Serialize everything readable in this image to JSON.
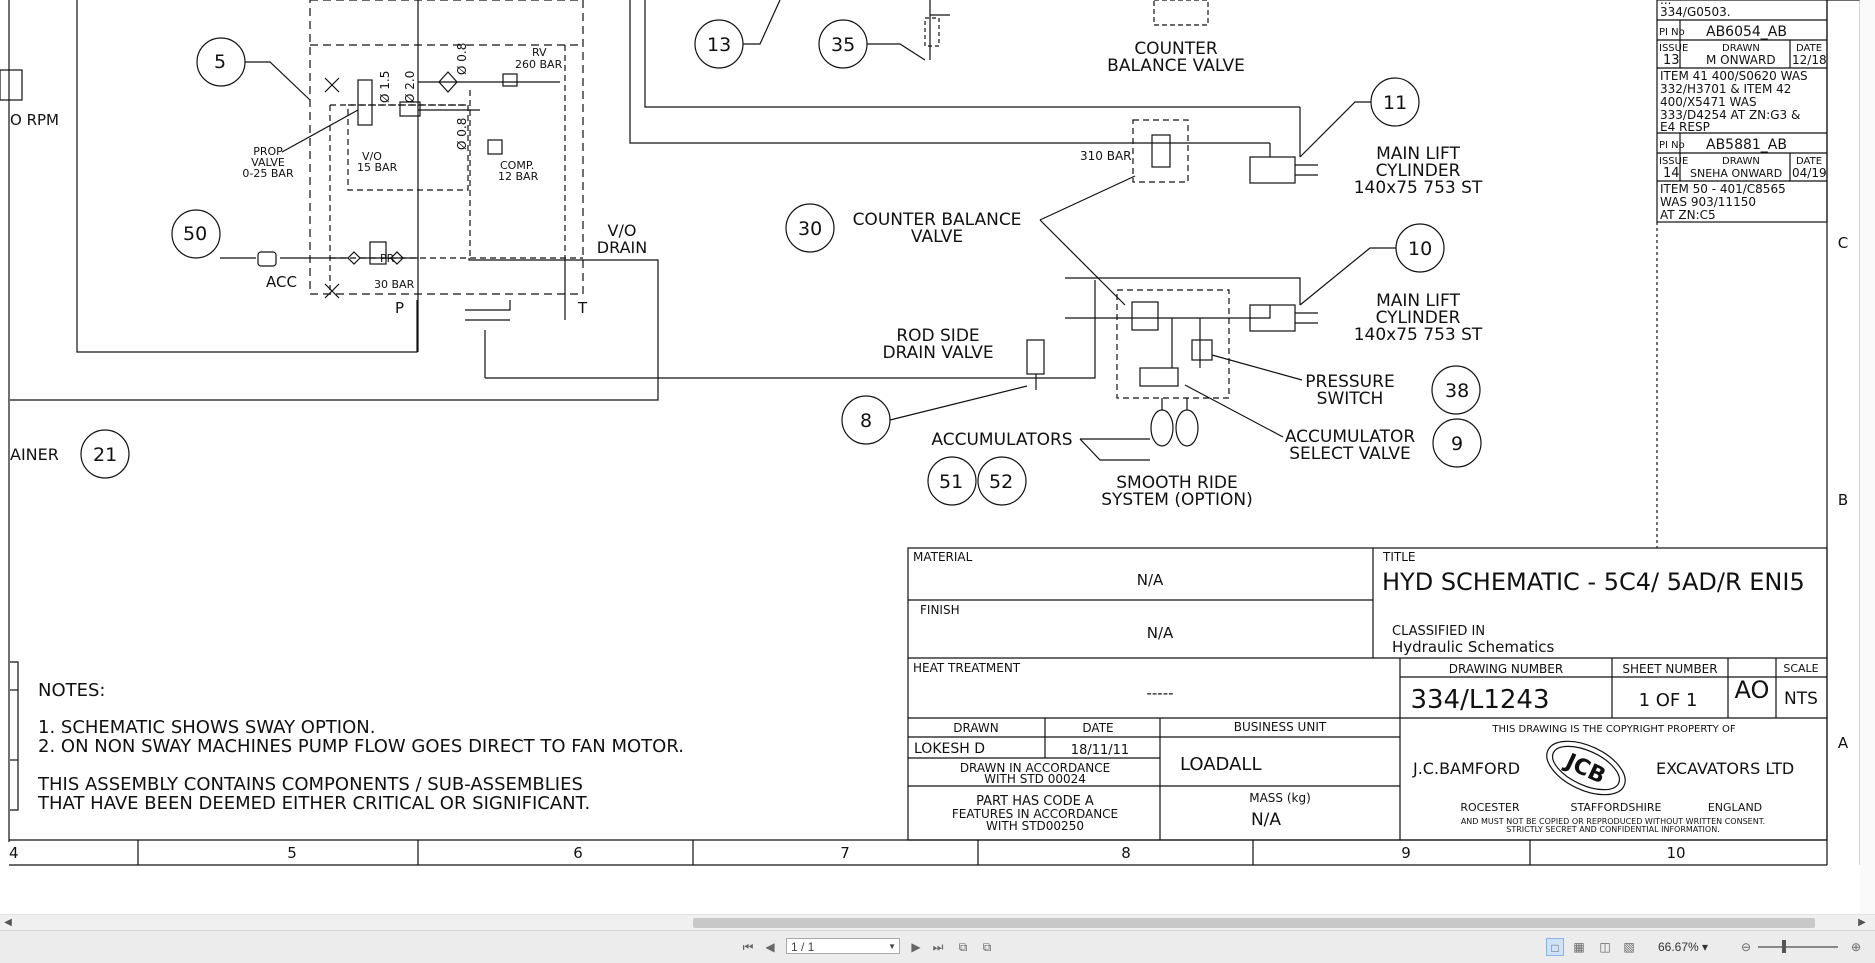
{
  "schematic": {
    "labels": {
      "rpm": "O RPM",
      "item5_num": "5",
      "prop_valve": [
        "PROP",
        "VALVE",
        "0-25 BAR"
      ],
      "vo_15": [
        "V/O",
        "15 BAR"
      ],
      "rv": [
        "RV",
        "260 BAR"
      ],
      "comp": [
        "COMP.",
        "12 BAR"
      ],
      "orifice_15": "Ø 1.5",
      "orifice_20": "Ø 2.0",
      "orifice_08a": "Ø 0.8",
      "orifice_08b": "Ø 0.8",
      "item50_num": "50",
      "acc": "ACC",
      "pr": [
        "PR",
        "30 BAR"
      ],
      "port_p": "P",
      "port_t": "T",
      "vo_drain": [
        "V/O",
        "DRAIN"
      ],
      "strainer": "AINER",
      "item21_num": "21",
      "item13_num": "13",
      "item35_num": "35",
      "counter_balance_top": [
        "COUNTER",
        "BALANCE VALVE"
      ],
      "bar310": "310 BAR",
      "item11_num": "11",
      "main_lift_1": [
        "MAIN LIFT",
        "CYLINDER",
        "140x75 753 ST"
      ],
      "item30_num": "30",
      "counter_balance_mid": [
        "COUNTER BALANCE",
        "VALVE"
      ],
      "item10_num": "10",
      "main_lift_2": [
        "MAIN LIFT",
        "CYLINDER",
        "140x75 753 ST"
      ],
      "rod_side": [
        "ROD SIDE",
        "DRAIN VALVE"
      ],
      "item8_num": "8",
      "pressure_switch": [
        "PRESSURE",
        "SWITCH"
      ],
      "item38_num": "38",
      "accumulators": "ACCUMULATORS",
      "accumulator_select": [
        "ACCUMULATOR",
        "SELECT VALVE"
      ],
      "item9_num": "9",
      "item51_num": "51",
      "item52_num": "52",
      "smooth_ride": [
        "SMOOTH RIDE",
        "SYSTEM (OPTION)"
      ]
    },
    "notes": {
      "heading": "NOTES:",
      "line1": "1. SCHEMATIC SHOWS SWAY OPTION.",
      "line2": "2. ON NON SWAY MACHINES PUMP FLOW GOES DIRECT TO FAN MOTOR.",
      "line3": "THIS ASSEMBLY CONTAINS COMPONENTS / SUB-ASSEMBLIES",
      "line4": "THAT HAVE BEEN DEEMED EITHER CRITICAL OR SIGNIFICANT."
    },
    "revisions": {
      "top_partial_1": "...",
      "top_partial_2": "334/G0503.",
      "pi1_label": "PI No",
      "pi1_value": "AB6054_AB",
      "issue_label": "ISSUE",
      "drawn_label": "DRAWN",
      "date_label": "DATE",
      "issue13": "13",
      "drawn13": "M ONWARD",
      "date13": "12/18",
      "note13": [
        "ITEM 41 400/S0620 WAS",
        "332/H3701 & ITEM 42",
        "400/X5471 WAS",
        "333/D4254 AT ZN:G3 &",
        "E4 RESP"
      ],
      "pi2_label": "PI No",
      "pi2_value": "AB5881_AB",
      "issue14": "14",
      "drawn14": "SNEHA ONWARD",
      "date14": "04/19",
      "note14": [
        "ITEM 50 - 401/C8565",
        "WAS 903/11150",
        "AT ZN:C5"
      ]
    },
    "title_block": {
      "material_label": "MATERIAL",
      "material_value": "N/A",
      "finish_label": "FINISH",
      "finish_value": "N/A",
      "heat_label": "HEAT TREATMENT",
      "heat_value": "-----",
      "title_label": "TITLE",
      "title_value": "HYD SCHEMATIC - 5C4/ 5AD/R ENI5",
      "classified_label": "CLASSIFIED IN",
      "classified_value": "Hydraulic Schematics",
      "drawing_number_label": "DRAWING NUMBER",
      "drawing_number_value": "334/L1243",
      "sheet_number_label": "SHEET NUMBER",
      "sheet_number_value": "1 OF 1",
      "size_value": "AO",
      "scale_label": "SCALE",
      "scale_value": "NTS",
      "drawn_label": "DRAWN",
      "drawn_value": "LOKESH D",
      "date_label": "DATE",
      "date_value": "18/11/11",
      "business_unit_label": "BUSINESS UNIT",
      "business_unit_value": "LOADALL",
      "accordance": [
        "DRAWN IN ACCORDANCE",
        "WITH STD 00024"
      ],
      "part_code": [
        "PART HAS CODE A",
        "FEATURES IN ACCORDANCE",
        "WITH STD00250"
      ],
      "mass_label": "MASS (kg)",
      "mass_value": "N/A",
      "copyright_top": "THIS DRAWING IS THE COPYRIGHT PROPERTY OF",
      "company_left": "J.C.BAMFORD",
      "company_right": "EXCAVATORS LTD",
      "logo_text": "JCB",
      "address": [
        "ROCESTER",
        "STAFFORDSHIRE",
        "ENGLAND"
      ],
      "copyright_bottom": [
        "AND MUST NOT BE COPIED OR REPRODUCED WITHOUT WRITTEN CONSENT.",
        "STRICTLY SECRET AND CONFIDENTIAL INFORMATION."
      ]
    },
    "grid": {
      "columns": [
        "4",
        "5",
        "6",
        "7",
        "8",
        "9",
        "10"
      ],
      "rows": [
        "C",
        "B",
        "A"
      ]
    }
  },
  "viewer": {
    "page_field": "1 / 1",
    "zoom": "66.67%",
    "nav_icons": [
      "first-page-icon",
      "previous-page-icon",
      "next-page-icon",
      "last-page-icon"
    ],
    "view_icons": [
      "single-page-icon",
      "continuous-icon",
      "two-page-icon",
      "two-page-continuous-icon"
    ]
  }
}
